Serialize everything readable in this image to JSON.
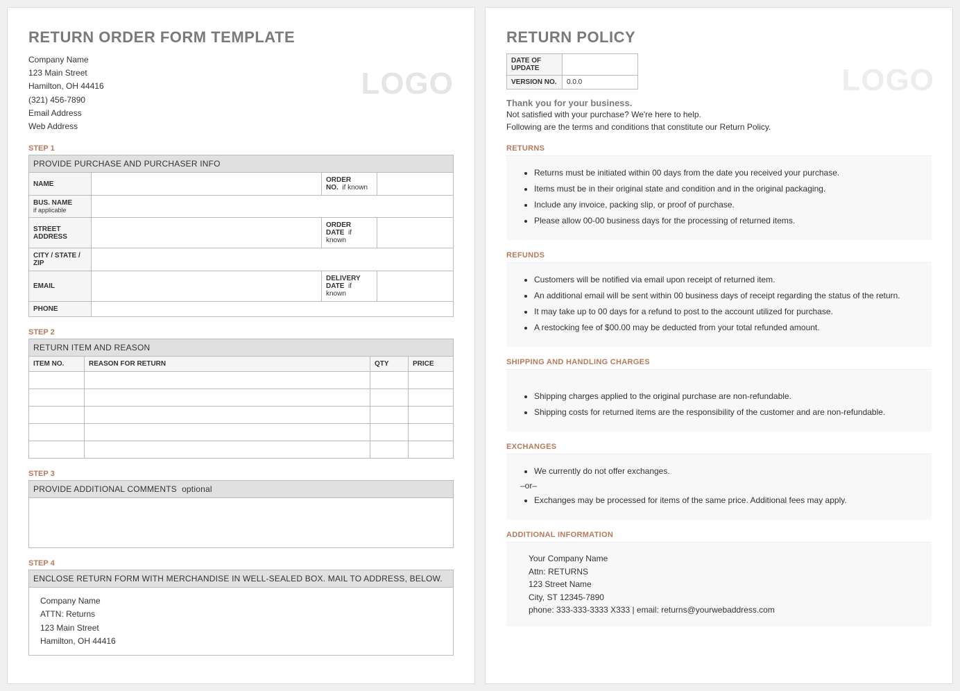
{
  "left": {
    "title": "RETURN ORDER FORM TEMPLATE",
    "company": {
      "name": "Company Name",
      "street": "123 Main Street",
      "citystate": "Hamilton, OH 44416",
      "phone": "(321) 456-7890",
      "email": "Email Address",
      "web": "Web Address"
    },
    "logo": "LOGO",
    "step1": {
      "label": "STEP 1",
      "header": "PROVIDE PURCHASE AND PURCHASER INFO",
      "fields": {
        "name": "NAME",
        "busname": "BUS. NAME",
        "busname_sub": "if applicable",
        "street": "STREET ADDRESS",
        "csz": "CITY / STATE / ZIP",
        "email": "EMAIL",
        "phone": "PHONE",
        "orderno": "ORDER NO.",
        "orderno_sub": "if known",
        "orderdate": "ORDER DATE",
        "orderdate_sub": "if known",
        "delivery": "DELIVERY DATE",
        "delivery_sub": "if known"
      }
    },
    "step2": {
      "label": "STEP 2",
      "header": "RETURN ITEM AND REASON",
      "cols": {
        "itemno": "ITEM NO.",
        "reason": "REASON FOR RETURN",
        "qty": "QTY",
        "price": "PRICE"
      }
    },
    "step3": {
      "label": "STEP 3",
      "header": "PROVIDE ADDITIONAL COMMENTS",
      "header_sub": "optional"
    },
    "step4": {
      "label": "STEP 4",
      "header": "ENCLOSE RETURN FORM WITH MERCHANDISE IN WELL-SEALED BOX.  MAIL TO ADDRESS, BELOW.",
      "ship": {
        "company": "Company Name",
        "attn": "ATTN: Returns",
        "street": "123 Main Street",
        "csz": "Hamilton, OH 44416"
      }
    }
  },
  "right": {
    "title": "RETURN POLICY",
    "logo": "LOGO",
    "policy_tbl": {
      "date_label": "DATE OF UPDATE",
      "ver_label": "VERSION NO.",
      "ver_value": "0.0.0"
    },
    "thankyou": "Thank you for your business.",
    "intro1": "Not satisfied with your purchase? We're here to help.",
    "intro2": "Following are the terms and conditions that constitute our Return Policy.",
    "returns": {
      "title": "RETURNS",
      "items": [
        "Returns must be initiated within 00 days from the date you received your purchase.",
        "Items must be in their original state and condition and in the original packaging.",
        "Include any invoice, packing slip, or proof of purchase.",
        "Please allow 00-00 business days for the processing of returned items."
      ]
    },
    "refunds": {
      "title": "REFUNDS",
      "items": [
        "Customers will be notified via email upon receipt of returned item.",
        "An additional email will be sent within 00 business days of receipt regarding the status of the return.",
        "It may take up to 00 days for a refund to post to the account utilized for purchase.",
        "A restocking fee of $00.00 may be deducted from your total refunded amount."
      ]
    },
    "shipping": {
      "title": "SHIPPING AND HANDLING CHARGES",
      "items": [
        "Shipping charges applied to the original purchase are non-refundable.",
        "Shipping costs for returned items are the responsibility of the customer and are non-refundable."
      ]
    },
    "exchanges": {
      "title": "EXCHANGES",
      "item1": "We currently do not offer exchanges.",
      "or": "–or–",
      "item2": "Exchanges may be processed for items of the same price. Additional fees may apply."
    },
    "additional": {
      "title": "ADDITIONAL INFORMATION",
      "l1": "Your Company Name",
      "l2": "Attn: RETURNS",
      "l3": "123 Street Name",
      "l4": "City, ST 12345-7890",
      "l5": "phone: 333-333-3333 X333    |    email: returns@yourwebaddress.com"
    }
  }
}
